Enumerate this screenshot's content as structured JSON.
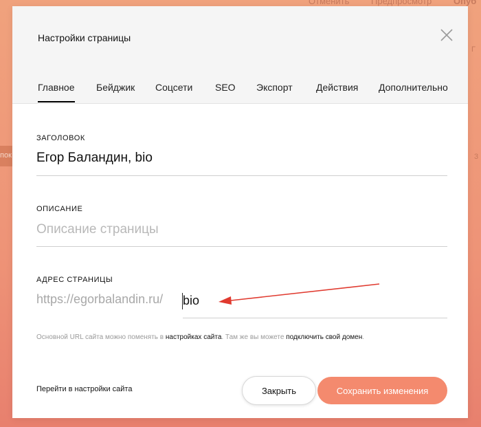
{
  "background": {
    "top_links": [
      "Отменить",
      "Предпросмотр",
      "Опуб"
    ],
    "left_tab_text": "пок",
    "right_edge_marks": [
      "Г",
      "3"
    ]
  },
  "modal": {
    "title": "Настройки страницы",
    "tabs": [
      {
        "label": "Главное",
        "active": true
      },
      {
        "label": "Бейджик",
        "active": false
      },
      {
        "label": "Соцсети",
        "active": false
      },
      {
        "label": "SEO",
        "active": false
      },
      {
        "label": "Экспорт",
        "active": false
      },
      {
        "label": "Действия",
        "active": false
      },
      {
        "label": "Дополнительно",
        "active": false
      }
    ],
    "fields": {
      "title": {
        "label": "ЗАГОЛОВОК",
        "value": "Егор Баландин, bio"
      },
      "description": {
        "label": "ОПИСАНИЕ",
        "value": "",
        "placeholder": "Описание страницы"
      },
      "address": {
        "label": "АДРЕС СТРАНИЦЫ",
        "prefix": "https://egorbalandin.ru/",
        "value": "bio"
      }
    },
    "hint": {
      "text_1": "Основной URL сайта можно поменять в ",
      "link_1": "настройках сайта",
      "text_2": ". Там же вы можете ",
      "link_2": "подключить свой домен",
      "text_3": "."
    },
    "footer": {
      "site_settings_link": "Перейти в настройки сайта",
      "close_label": "Закрыть",
      "save_label": "Сохранить изменения"
    }
  },
  "colors": {
    "accent": "#f48a6e",
    "annotation_arrow": "#e03a2f"
  }
}
